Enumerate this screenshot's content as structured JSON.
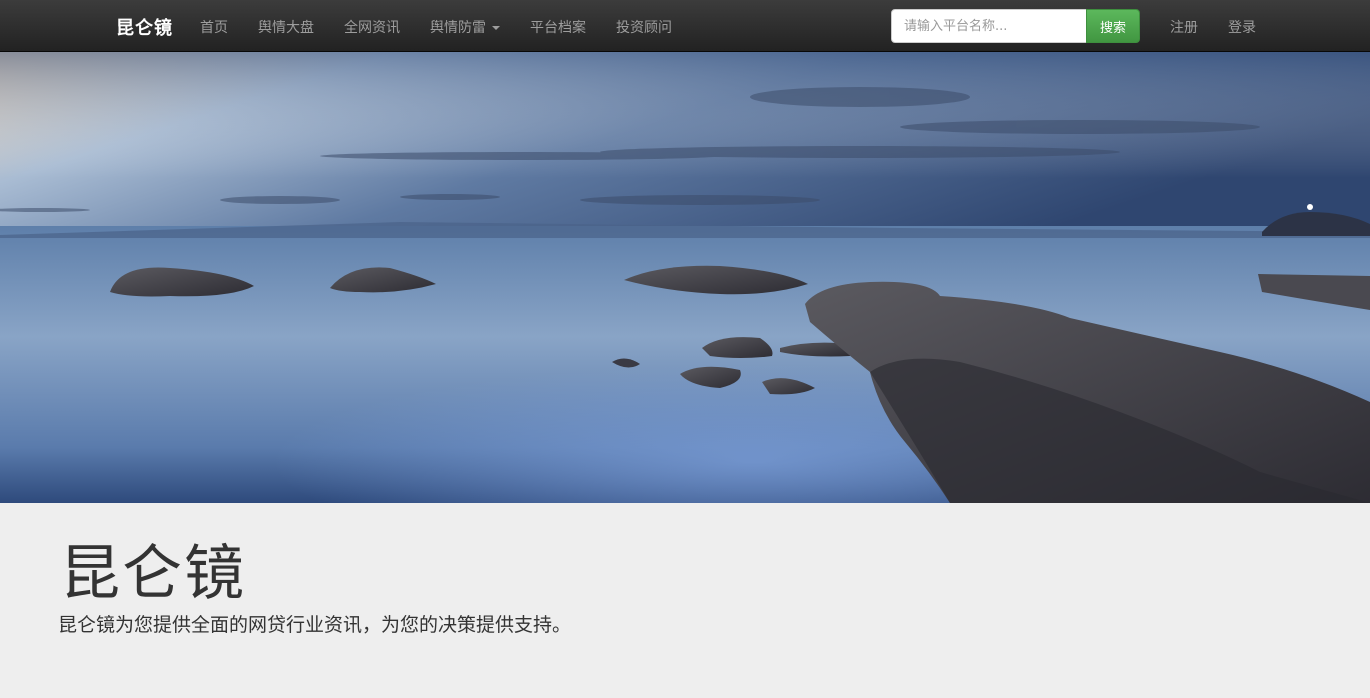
{
  "navbar": {
    "brand": "昆仑镜",
    "items": [
      {
        "label": "首页"
      },
      {
        "label": "舆情大盘"
      },
      {
        "label": "全网资讯"
      },
      {
        "label": "舆情防雷"
      },
      {
        "label": "平台档案"
      },
      {
        "label": "投资顾问"
      }
    ],
    "search_placeholder": "请输入平台名称...",
    "search_button": "搜索",
    "register": "注册",
    "login": "登录"
  },
  "jumbotron": {
    "title": "昆仑镜",
    "subtitle": "昆仑镜为您提供全面的网贷行业资讯，为您的决策提供支持。"
  },
  "colors": {
    "navbar_bg": "#222222",
    "search_button_bg": "#5cb85c",
    "jumbotron_bg": "#eeeeee"
  }
}
